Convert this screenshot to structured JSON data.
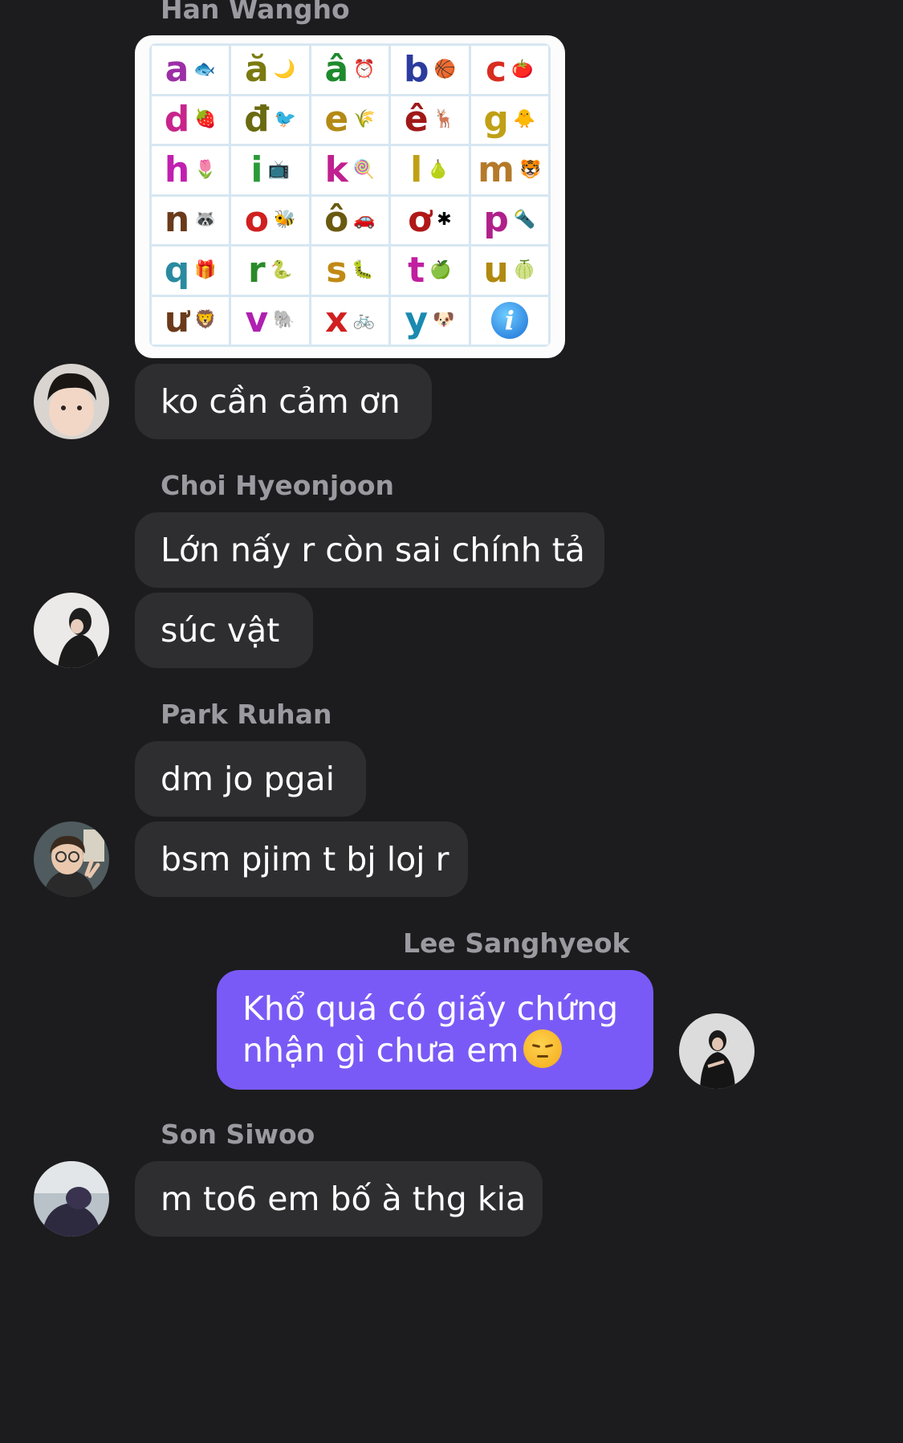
{
  "colors": {
    "background": "#1c1c1e",
    "bubble": "#2e2e30",
    "my_bubble": "#7a5af6",
    "sender_name": "#9a9aa0"
  },
  "messages": {
    "han": {
      "sender": "Han Wangho",
      "text": "ko cần cảm ơn"
    },
    "choi": {
      "sender": "Choi Hyeonjoon",
      "text1": "Lớn nấy r còn sai chính tả",
      "text2": "súc vật"
    },
    "park": {
      "sender": "Park Ruhan",
      "text1": "dm jo pgai",
      "text2": "bsm pjim t bj loj r"
    },
    "lee": {
      "sender": "Lee Sanghyeok",
      "text": "Khổ quá có giấy chứng nhận gì chưa em"
    },
    "son": {
      "sender": "Son Siwoo",
      "text": "m to6 em bố à thg kia"
    }
  },
  "alphabet_image": {
    "cells": [
      {
        "letter": "a",
        "color": "#9b2fa6",
        "icon": "🐟"
      },
      {
        "letter": "ă",
        "color": "#7a7a10",
        "icon": "🌙"
      },
      {
        "letter": "â",
        "color": "#1f8a2d",
        "icon": "⏰"
      },
      {
        "letter": "b",
        "color": "#2b3c9e",
        "icon": "🏀"
      },
      {
        "letter": "c",
        "color": "#d82d20",
        "icon": "🍅"
      },
      {
        "letter": "d",
        "color": "#c8248c",
        "icon": "🍓"
      },
      {
        "letter": "đ",
        "color": "#6a6a10",
        "icon": "🐦"
      },
      {
        "letter": "e",
        "color": "#b48a15",
        "icon": "🌾"
      },
      {
        "letter": "ê",
        "color": "#a01818",
        "icon": "🦌"
      },
      {
        "letter": "g",
        "color": "#c0a015",
        "icon": "🐥"
      },
      {
        "letter": "h",
        "color": "#c020b0",
        "icon": "🌷"
      },
      {
        "letter": "i",
        "color": "#2a9a3a",
        "icon": "📺"
      },
      {
        "letter": "k",
        "color": "#c02090",
        "icon": "🍭"
      },
      {
        "letter": "l",
        "color": "#c0a015",
        "icon": "🍐"
      },
      {
        "letter": "m",
        "color": "#b47a2a",
        "icon": "🐯"
      },
      {
        "letter": "n",
        "color": "#6a3a1a",
        "icon": "🦝"
      },
      {
        "letter": "o",
        "color": "#d02020",
        "icon": "🐝"
      },
      {
        "letter": "ô",
        "color": "#6a5a10",
        "icon": "🚗"
      },
      {
        "letter": "ơ",
        "color": "#b01818",
        "icon": "✱"
      },
      {
        "letter": "p",
        "color": "#b0208a",
        "icon": "🔦"
      },
      {
        "letter": "q",
        "color": "#2a8aa0",
        "icon": "🎁"
      },
      {
        "letter": "r",
        "color": "#2a8a2a",
        "icon": "🐍"
      },
      {
        "letter": "s",
        "color": "#c08a15",
        "icon": "🐛"
      },
      {
        "letter": "t",
        "color": "#c020a0",
        "icon": "🍏"
      },
      {
        "letter": "u",
        "color": "#b08a10",
        "icon": "🍈"
      },
      {
        "letter": "ư",
        "color": "#6a3a1a",
        "icon": "🦁"
      },
      {
        "letter": "v",
        "color": "#b020b0",
        "icon": "🐘"
      },
      {
        "letter": "x",
        "color": "#d02020",
        "icon": "🚲"
      },
      {
        "letter": "y",
        "color": "#1a8ab0",
        "icon": "🐶"
      },
      {
        "letter": "",
        "color": "#1a6fd6",
        "icon": "info-icon"
      }
    ]
  }
}
